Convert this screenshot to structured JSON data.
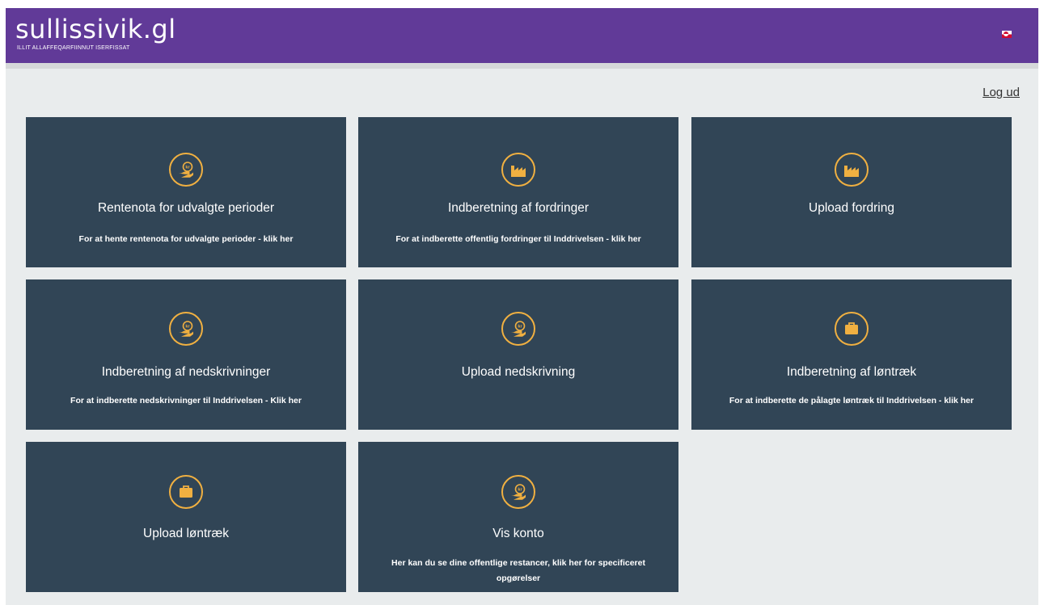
{
  "header": {
    "brand": "sullissivik.gl",
    "tagline": "ILLIT ALLAFFEQARFIINNUT ISERFISSAT",
    "language_flag": "greenland-flag-icon"
  },
  "nav": {
    "logout_label": "Log ud"
  },
  "colors": {
    "header_bg": "#613a98",
    "page_bg": "#e9eced",
    "tile_bg": "#314556",
    "icon_accent": "#f0b041"
  },
  "tiles": [
    {
      "icon": "money-hand-icon",
      "title": "Rentenota for udvalgte perioder",
      "desc": "For at hente rentenota for udvalgte perioder - klik her"
    },
    {
      "icon": "factory-icon",
      "title": "Indberetning af fordringer",
      "desc": "For at indberette offentlig fordringer til Inddrivelsen - klik her"
    },
    {
      "icon": "factory-icon",
      "title": "Upload fordring",
      "desc": ""
    },
    {
      "icon": "money-hand-icon",
      "title": "Indberetning af nedskrivninger",
      "desc": "For at indberette nedskrivninger til Inddrivelsen - Klik her"
    },
    {
      "icon": "money-hand-icon",
      "title": "Upload nedskrivning",
      "desc": ""
    },
    {
      "icon": "briefcase-icon",
      "title": "Indberetning af løntræk",
      "desc": "For at indberette de pålagte løntræk til Inddrivelsen - klik her"
    },
    {
      "icon": "briefcase-icon",
      "title": "Upload løntræk",
      "desc": ""
    },
    {
      "icon": "money-hand-icon",
      "title": "Vis konto",
      "desc": "Her kan du se dine offentlige restancer, klik her for specificeret opgørelser"
    }
  ]
}
